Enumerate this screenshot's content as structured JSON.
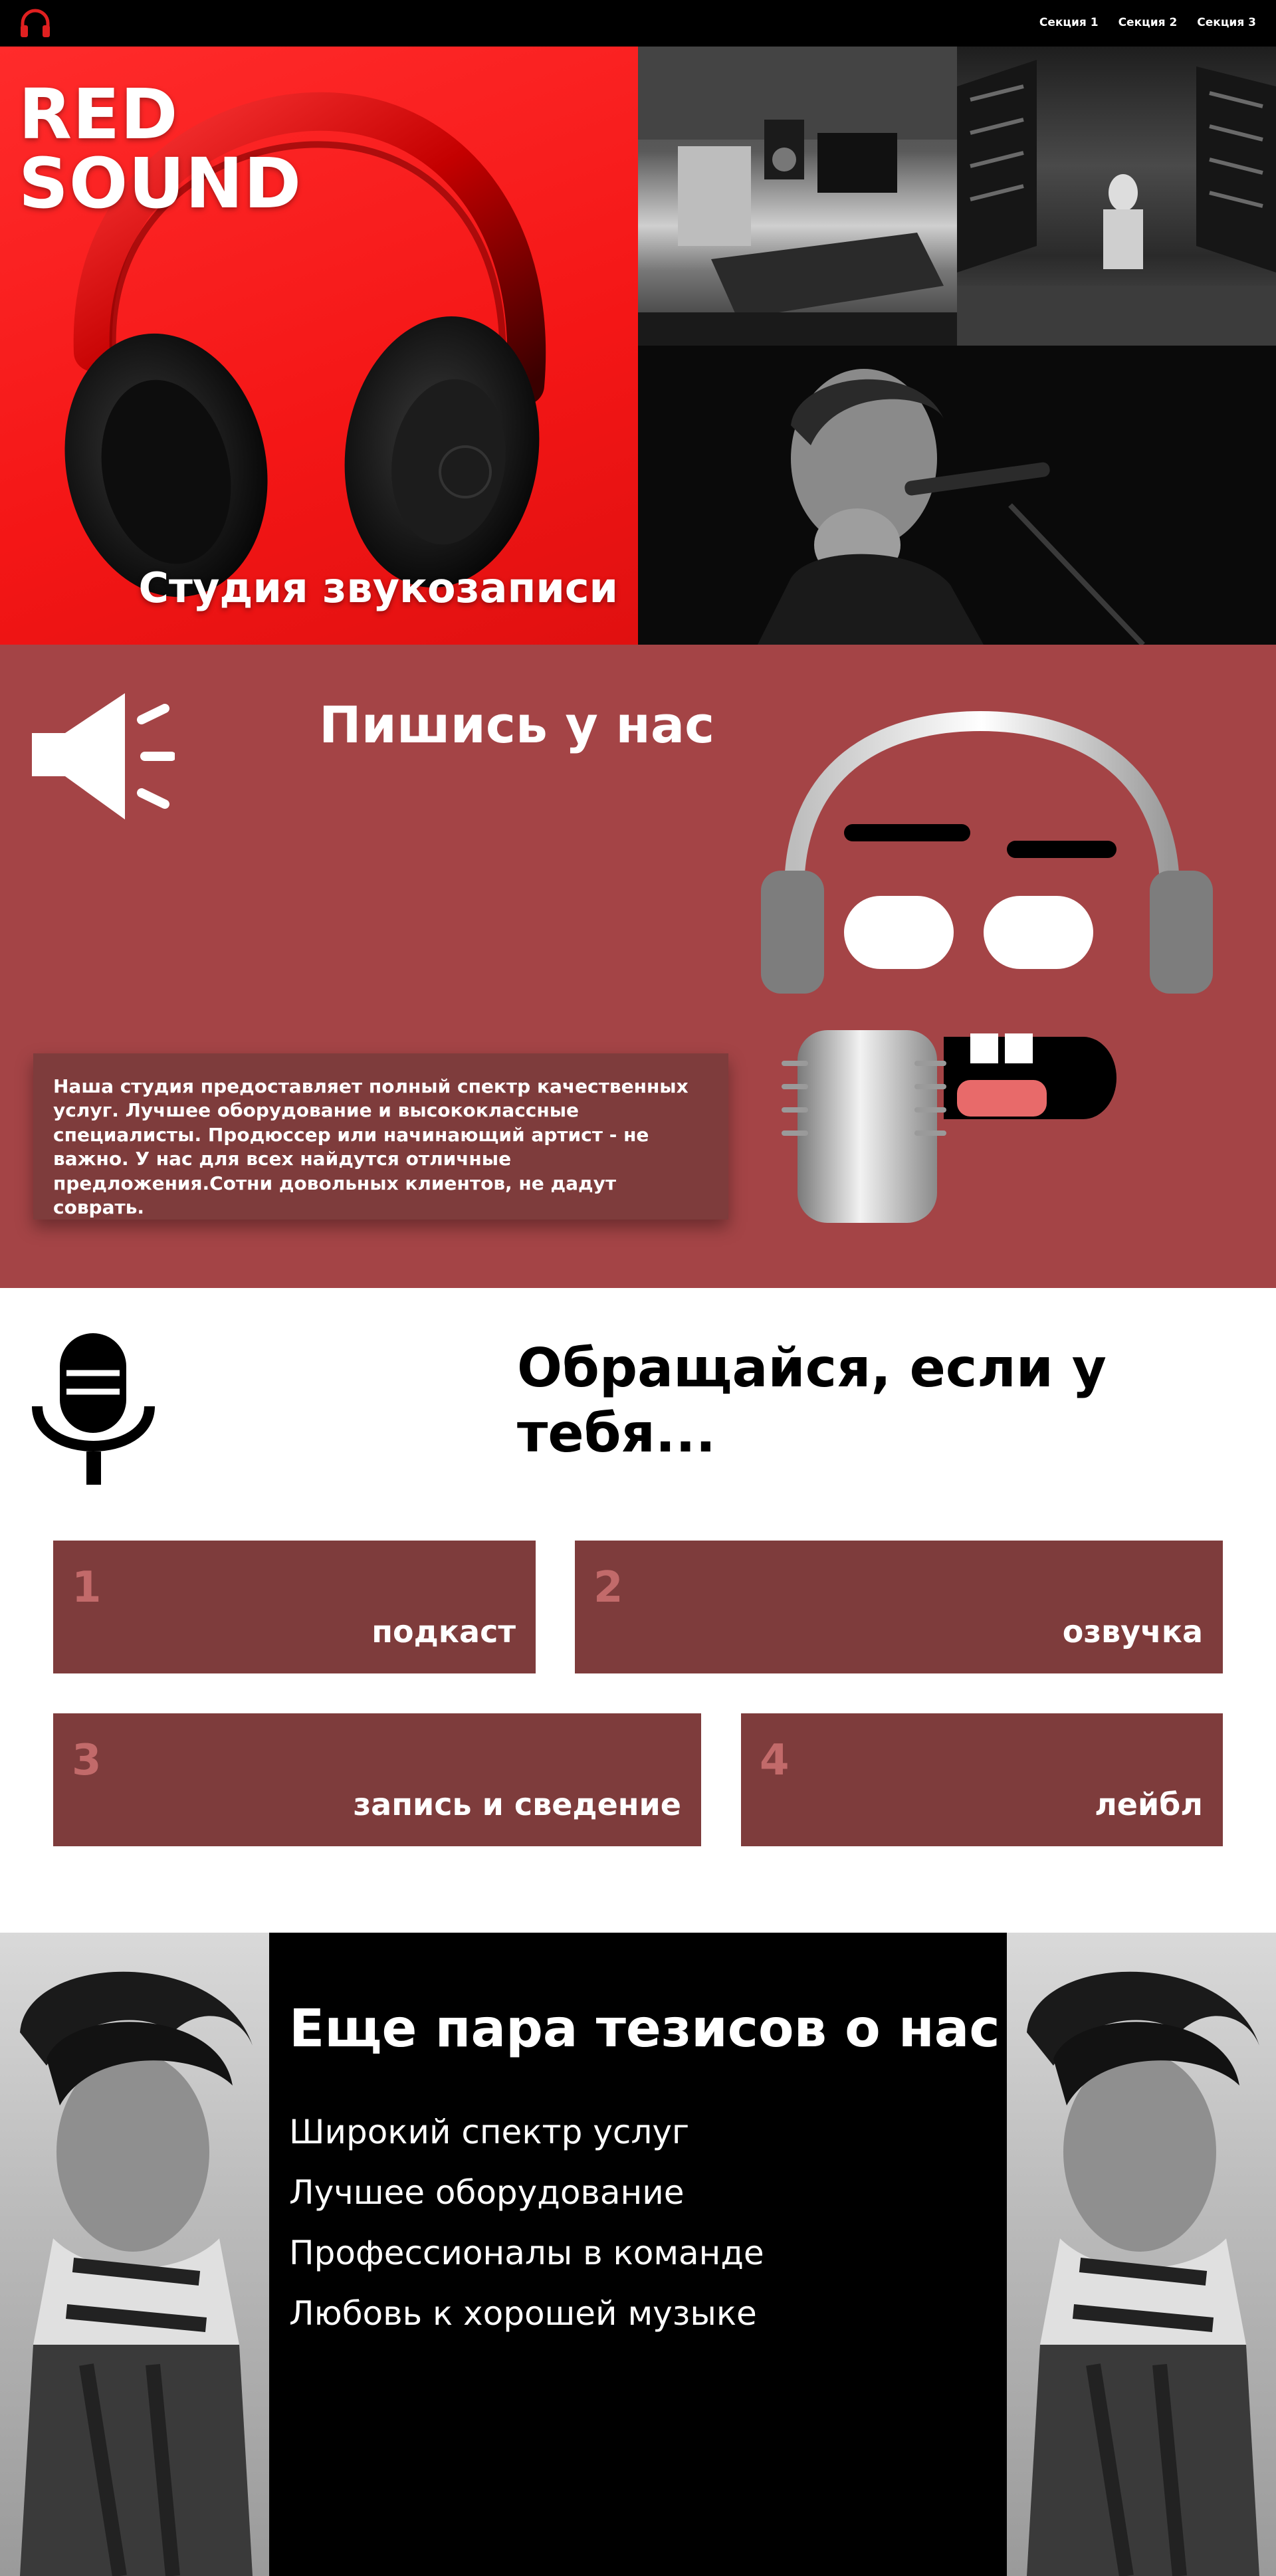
{
  "nav": {
    "logo_icon": "headphones-icon",
    "links": [
      "Секция 1",
      "Секция 2",
      "Секция 3"
    ]
  },
  "hero": {
    "title_line1": "RED",
    "title_line2": "SOUND",
    "subtitle": "Студия звукозаписи",
    "accent": "#f41616"
  },
  "section2": {
    "title": "Пишись у нас",
    "speaker_icon": "speaker-icon",
    "text": "Наша студия предоставляет полный спектр качественных услуг. Лучшее оборудование и высококлассные специалисты. Продюссер или начинающий артист - не важно. У нас для всех найдутся отличные предложения.Сотни довольных клиентов, не дадут соврать.",
    "background": "#a44446",
    "card_color": "#7e3c3c"
  },
  "section3": {
    "title": "Обращайся, если у тебя...",
    "mic_icon": "microphone-icon",
    "services": [
      {
        "num": "1",
        "label": "подкаст"
      },
      {
        "num": "2",
        "label": "озвучка"
      },
      {
        "num": "3",
        "label": "запись и сведение"
      },
      {
        "num": "4",
        "label": "лейбл"
      }
    ]
  },
  "section4": {
    "title": "Еще пара тезисов о нас",
    "theses": [
      "Широкий спектр услуг",
      "Лучшее оборудование",
      "Профессионалы в команде",
      "Любовь к хорошей музыке"
    ]
  }
}
